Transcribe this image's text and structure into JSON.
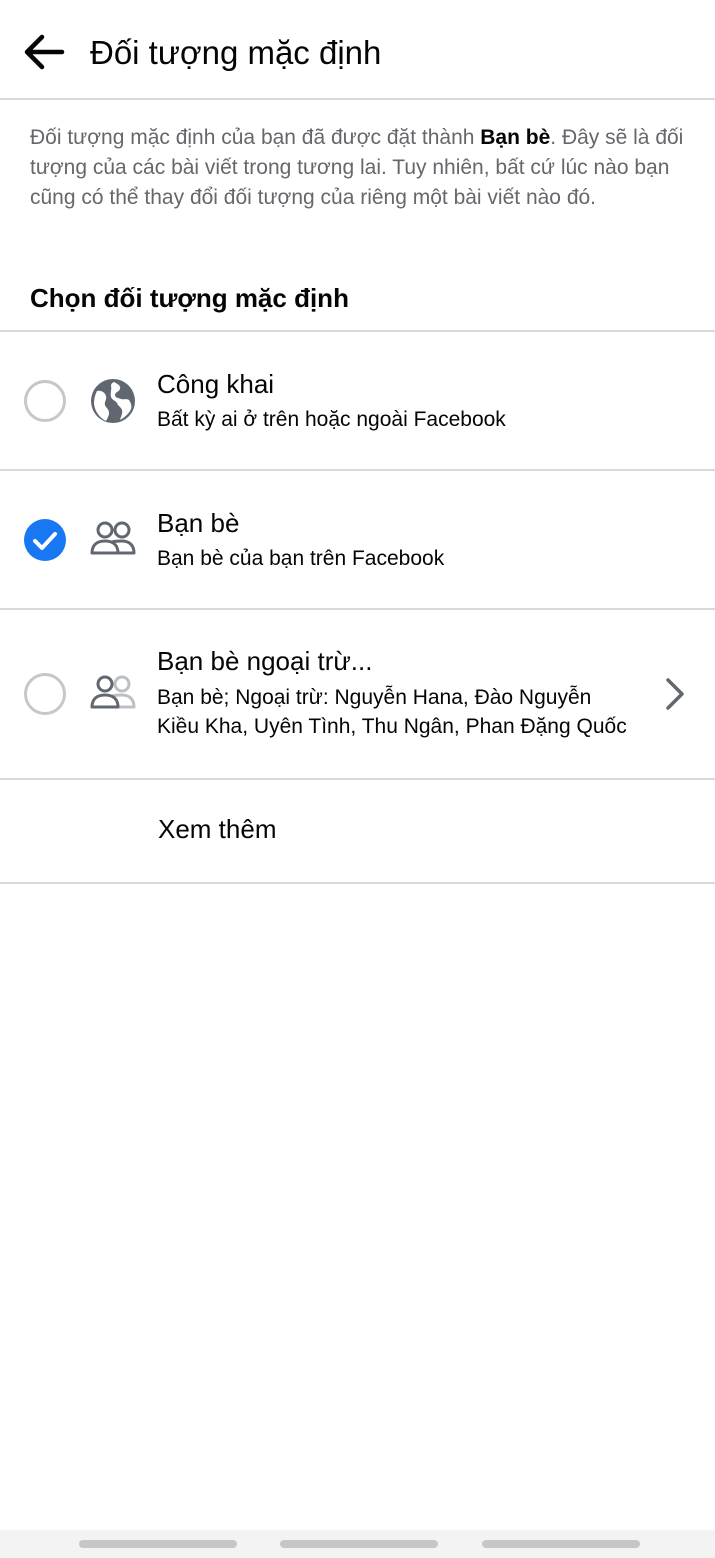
{
  "header": {
    "title": "Đối tượng mặc định"
  },
  "description": {
    "prefix": "Đối tượng mặc định của bạn đã được đặt thành ",
    "highlight": "Bạn bè",
    "suffix": ". Đây sẽ là đối tượng của các bài viết trong tương lai. Tuy nhiên, bất cứ lúc nào bạn cũng có thể thay đổi đối tượng của riêng một bài viết nào đó."
  },
  "section_heading": "Chọn đối tượng mặc định",
  "options": [
    {
      "title": "Công khai",
      "subtitle": "Bất kỳ ai ở trên hoặc ngoài Facebook",
      "icon": "globe-icon",
      "selected": false
    },
    {
      "title": "Bạn bè",
      "subtitle": "Bạn bè của bạn trên Facebook",
      "icon": "friends-icon",
      "selected": true
    },
    {
      "title": "Bạn bè ngoại trừ...",
      "subtitle_line1": "Bạn bè; Ngoại trừ: Nguyễn Hana, Đào Nguyễn",
      "subtitle_line2": "Kiều Kha, Uyên Tình, Thu Ngân, Phan Đặng Quốc",
      "icon": "friends-except-icon",
      "selected": false
    }
  ],
  "see_more_label": "Xem thêm",
  "colors": {
    "accent": "#1877f2",
    "divider": "#d9d9db",
    "secondary_text": "#65676b",
    "icon": "#606770"
  }
}
